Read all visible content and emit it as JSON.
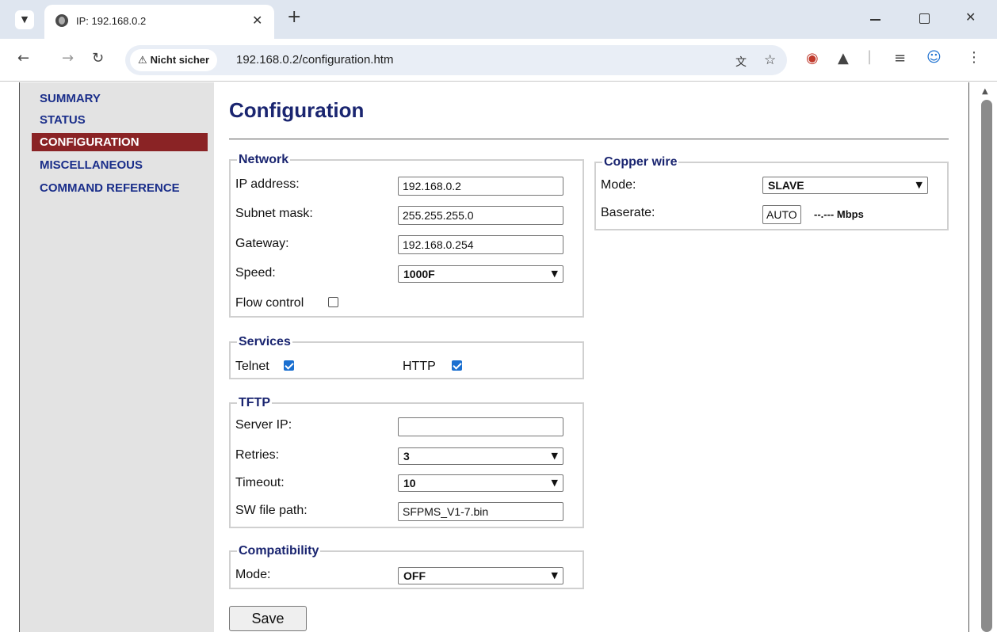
{
  "browser": {
    "tab_title": "IP: 192.168.0.2",
    "security_label": "Nicht sicher",
    "url": "192.168.0.2/configuration.htm"
  },
  "sidebar": {
    "items": [
      {
        "label": "SUMMARY",
        "active": false
      },
      {
        "label": "STATUS",
        "active": false
      },
      {
        "label": "CONFIGURATION",
        "active": true
      },
      {
        "label": "MISCELLANEOUS",
        "active": false
      },
      {
        "label": "COMMAND REFERENCE",
        "active": false
      }
    ]
  },
  "page": {
    "title": "Configuration"
  },
  "network": {
    "legend": "Network",
    "ip_label": "IP address:",
    "ip_value": "192.168.0.2",
    "subnet_label": "Subnet mask:",
    "subnet_value": "255.255.255.0",
    "gateway_label": "Gateway:",
    "gateway_value": "192.168.0.254",
    "speed_label": "Speed:",
    "speed_value": "1000F",
    "flow_label": "Flow control",
    "flow_checked": false
  },
  "services": {
    "legend": "Services",
    "telnet_label": "Telnet",
    "telnet_checked": true,
    "http_label": "HTTP",
    "http_checked": true
  },
  "tftp": {
    "legend": "TFTP",
    "server_label": "Server IP:",
    "server_value": "",
    "retries_label": "Retries:",
    "retries_value": "3",
    "timeout_label": "Timeout:",
    "timeout_value": "10",
    "path_label": "SW file path:",
    "path_value": "SFPMS_V1-7.bin"
  },
  "compatibility": {
    "legend": "Compatibility",
    "mode_label": "Mode:",
    "mode_value": "OFF"
  },
  "copper": {
    "legend": "Copper wire",
    "mode_label": "Mode:",
    "mode_value": "SLAVE",
    "baserate_label": "Baserate:",
    "baserate_value": "AUTO",
    "baserate_readout": "--.--- Mbps"
  },
  "actions": {
    "save_label": "Save"
  }
}
